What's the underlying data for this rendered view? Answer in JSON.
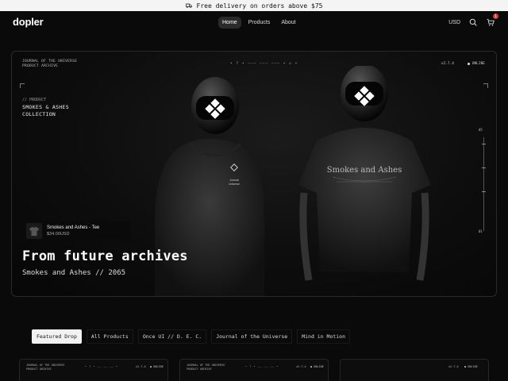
{
  "announcement": {
    "text": "Free delivery on orders above $75",
    "icon": "truck-icon"
  },
  "nav": {
    "logo": "dopler",
    "menu": [
      {
        "label": "Home",
        "active": true
      },
      {
        "label": "Products",
        "active": false
      },
      {
        "label": "About",
        "active": false
      }
    ],
    "currency": "USD",
    "cart_count": "1"
  },
  "hero": {
    "meta_line1": "JOURNAL OF THE UNIVERSE",
    "meta_line2": "PRODUCT ARCHIVE",
    "dots": "• ? • ——— ——— ——— • ◇ •",
    "version": "v2.7.4",
    "status": "ONLINE",
    "product_tag": "// PRODUCT",
    "product_title_line1": "SMOKES & ASHES",
    "product_title_line2": "COLLECTION",
    "scroll_number": "05",
    "scroll_end": "01",
    "shirt_print": "Smokes and Ashes",
    "hoodie_print_line1": "Journal",
    "hoodie_print_line2": "Universe",
    "product_card": {
      "name": "Smokes and Ashes - Tee",
      "price": "$34.00USD"
    },
    "headline": "From future archives",
    "subheadline": "Smokes and Ashes // 2065"
  },
  "tabs": [
    {
      "label": "Featured Drop",
      "active": true
    },
    {
      "label": "All Products",
      "active": false
    },
    {
      "label": "Once UI // D. E. C.",
      "active": false
    },
    {
      "label": "Journal of the Universe",
      "active": false
    },
    {
      "label": "Mind in Motion",
      "active": false
    }
  ],
  "previews": [
    {
      "meta1": "JOURNAL OF THE UNIVERSE",
      "meta2": "PRODUCT ARCHIVE",
      "dots": "• ? • —— —— —— •",
      "version": "v2.7.4",
      "status": "● ONLINE"
    },
    {
      "meta1": "JOURNAL OF THE UNIVERSE",
      "meta2": "PRODUCT ARCHIVE",
      "dots": "• ? • —— —— —— •",
      "version": "v2.7.4",
      "status": "● ONLINE"
    },
    {
      "meta1": "",
      "meta2": "",
      "dots": "",
      "version": "v2.7.4",
      "status": "● ONLINE"
    }
  ],
  "colors": {
    "background": "#0a0a0a",
    "accent": "#f2f2f2",
    "badge": "#d83a3a"
  }
}
